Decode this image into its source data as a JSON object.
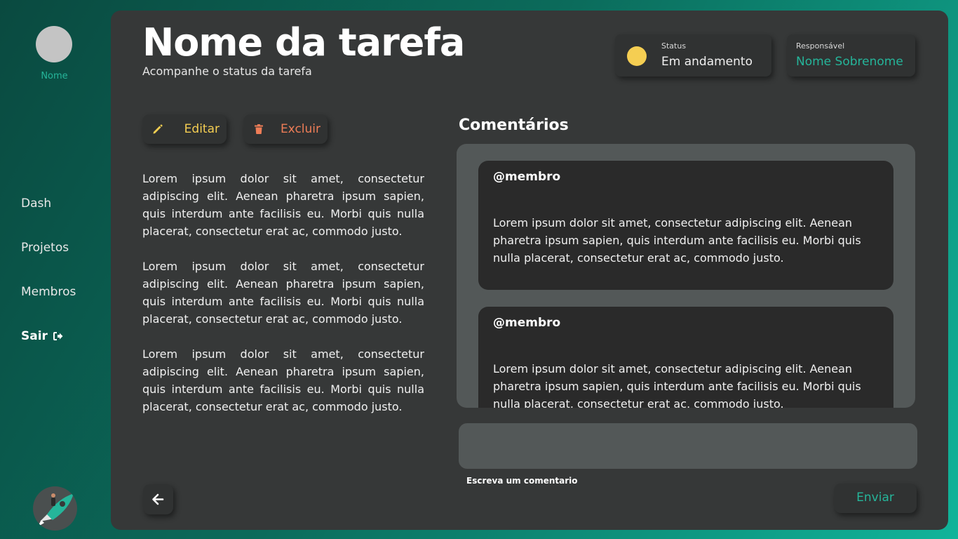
{
  "sidebar": {
    "user_name": "Nome",
    "items": [
      {
        "label": "Dash"
      },
      {
        "label": "Projetos"
      },
      {
        "label": "Membros"
      },
      {
        "label": "Sair"
      }
    ]
  },
  "header": {
    "title": "Nome da tarefa",
    "subtitle": "Acompanhe o status da tarefa"
  },
  "status": {
    "label": "Status",
    "value": "Em andamento",
    "color": "#f5ce52"
  },
  "responsible": {
    "label": "Responsável",
    "value": "Nome Sobrenome"
  },
  "actions": {
    "edit_label": "Editar",
    "delete_label": "Excluir"
  },
  "description": [
    "Lorem ipsum dolor sit amet, consectetur adipiscing elit. Aenean pharetra ipsum sapien, quis interdum ante facilisis eu. Morbi quis nulla placerat, consectetur erat ac, commodo justo.",
    "Lorem ipsum dolor sit amet, consectetur adipiscing elit. Aenean pharetra ipsum sapien, quis interdum ante facilisis eu. Morbi quis nulla placerat, consectetur erat ac, commodo justo.",
    "Lorem ipsum dolor sit amet, consectetur adipiscing elit. Aenean pharetra ipsum sapien, quis interdum ante facilisis eu. Morbi quis nulla placerat, consectetur erat ac, commodo justo."
  ],
  "comments": {
    "title": "Comentários",
    "items": [
      {
        "author": "@membro",
        "text": "Lorem ipsum dolor sit amet, consectetur adipiscing elit. Aenean pharetra ipsum sapien, quis interdum ante facilisis eu. Morbi quis nulla placerat, consectetur erat ac, commodo justo."
      },
      {
        "author": "@membro",
        "text": "Lorem ipsum dolor sit amet, consectetur adipiscing elit. Aenean pharetra ipsum sapien, quis interdum ante facilisis eu. Morbi quis nulla placerat, consectetur erat ac, commodo justo."
      }
    ],
    "input_label": "Escreva um comentario",
    "input_value": "",
    "send_label": "Enviar"
  },
  "colors": {
    "accent": "#25b59a",
    "edit": "#f5ce52",
    "delete": "#ee7d57",
    "panel": "#363838"
  }
}
